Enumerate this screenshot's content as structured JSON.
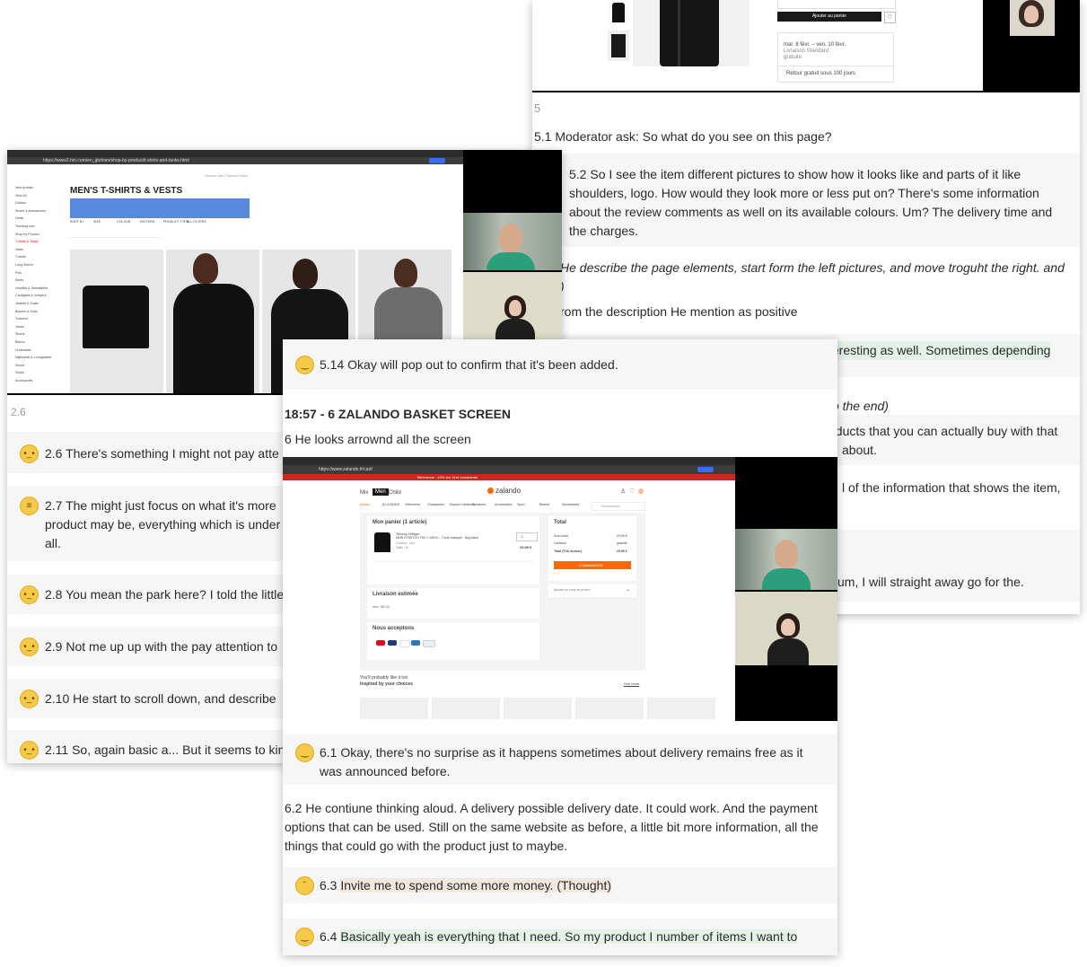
{
  "top_right": {
    "add_to_cart": "Ajouter au panier",
    "delivery_text": "mar. 8 févr. – ven. 10 févr.",
    "delivery_sub": "Livraison Standard",
    "delivery_free": "gratuite",
    "returns": "Retour gratuit sous 100 jours",
    "section_num": "5",
    "q51": "5.1 Moderator ask: So what do you see on this page?",
    "q52": "5.2 So I see the item different pictures to show how it looks like and parts of it like shoulders, logo. How would they look more or less put on? There's some information about the review comments as well on its available colours. Um? The delivery time and the charges.",
    "note_italic_a": "He describe the page elements, start form the left pictures, and move troguht the right. and",
    "note_italic_b": ")",
    "note_desc": "rom the description He mention as positive",
    "frag_interesting": "teresting as well. Sometimes depending",
    "frag_end": "to the end)",
    "frag_products_a": "oducts that you can actually buy with that",
    "frag_products_b": "about.",
    "frag_info_a": "l of the information that shows the item,",
    "frag_straight": "um, I will straight away go for the."
  },
  "left_card": {
    "site_url": "https://www2.hm.com/en_gb/men/shop-by-product/t-shirts-and-tanks.html",
    "banner": "Women  Men  Tutorial Rana",
    "page_title": "MEN'S T-SHIRTS & VESTS",
    "sidebar": [
      "New Arrivals",
      "View All",
      "Clothes",
      "Shoes & Accessories",
      "Deals",
      "Trending now",
      "Shop by Product",
      "T-shirts & Tanks",
      "Vests",
      "T-shirts",
      "Long Sleeve",
      "Polo",
      "Shirts",
      "Hoodies & Sweatshirts",
      "Cardigans & Jumpers",
      "Jackets & Coats",
      "Blazers & Suits",
      "Trousers",
      "Jeans",
      "Shorts",
      "Basics",
      "Underwear",
      "Nightwear & Loungewear",
      "Shoes",
      "Socks",
      "Accessories"
    ],
    "filters": [
      "SORT BY",
      "SIZE",
      "COLOUR",
      "PATTERN",
      "PRODUCT TYPE",
      "ALL FILTERS"
    ],
    "section_num": "2.6",
    "rows": [
      {
        "id": "2.6",
        "text": "2.6 There's something I might not pay atte"
      },
      {
        "id": "2.7",
        "text": "2.7 The might just focus on what it's more",
        "text2": "product may be, everything which is under",
        "text3": "all."
      },
      {
        "id": "2.8",
        "text": "2.8 You mean the park here? I told the little"
      },
      {
        "id": "2.9",
        "text": "2.9 Not me up up with the pay attention to"
      },
      {
        "id": "2.10",
        "text": "2.10 He start to scroll down, and describe"
      },
      {
        "id": "2.11",
        "text": "2.11 So, again basic a... But it seems to kin"
      }
    ]
  },
  "front_card": {
    "row_514": "5.14 Okay will pop out to confirm that it's been added.",
    "heading": "18:57 - 6 ZALANDO BASKET SCREEN",
    "sub": "6 He looks arrownd all the screen",
    "zalando": {
      "url": "https://www.zalando.fr/cart/",
      "promo": "Bienvenue: -15% sur 1ère commande",
      "nav_tabs": [
        "Mix",
        "Men",
        "Child"
      ],
      "logo": "zalando",
      "categories": [
        "Entdec",
        "À LA MODE",
        "Vêtements",
        "Chaussures",
        "Espace créateurs",
        "Sneakers",
        "Accessoires",
        "Sport",
        "Beauté",
        "Nouveautés"
      ],
      "search": "Rechercher",
      "cart_title": "Mon panier (1 article)",
      "item_brand": "Tommy Hilfiger",
      "item_name": "NEW STRETCH TEE C-NECK - T-shirt basique - flag black",
      "item_color": "Couleur : noir",
      "item_size": "Taille : M",
      "item_price": "29,99 €",
      "qty": "1",
      "total_title": "Total",
      "subtotal_label": "Sous-total",
      "subtotal": "29,99 €",
      "ship_label": "Livraison",
      "ship": "gratuite",
      "total_label": "Total (TVA incluse)",
      "total": "29,99 €",
      "order_btn": "COMMANDER",
      "promo_code": "Ajouter un code de promo",
      "delivery_title": "Livraison estimée",
      "delivery_date": "mer. 08.02.",
      "payment_title": "Nous acceptons",
      "recommend_a": "You'll probably like it too",
      "recommend_b": "Inspired by your choices",
      "see_more": "See more"
    },
    "row_61_a": "6.1 Okay, there's no surprise as it happens sometimes about delivery remains free as it",
    "row_61_b": "was announced before.",
    "row_62_a": "6.2 He contiune thinking aloud. A delivery possible delivery date. It could work. And the payment",
    "row_62_b": "options that can be used. Still on the same website as before, a little bit more information, all the",
    "row_62_c": "things that could go with the product just to maybe.",
    "row_63_prefix": "6.3 ",
    "row_63_hl": "Invite me to spend some more money. (Thought)",
    "row_64_prefix": "6.4 ",
    "row_64_hl": "Basically yeah is everything that I need. So my product I number of items I want to"
  },
  "colors": {
    "zalando_orange": "#ff6900",
    "hm_red": "#e50010",
    "highlight_green": "#e3f1e6",
    "highlight_beige": "#f0e7df"
  }
}
